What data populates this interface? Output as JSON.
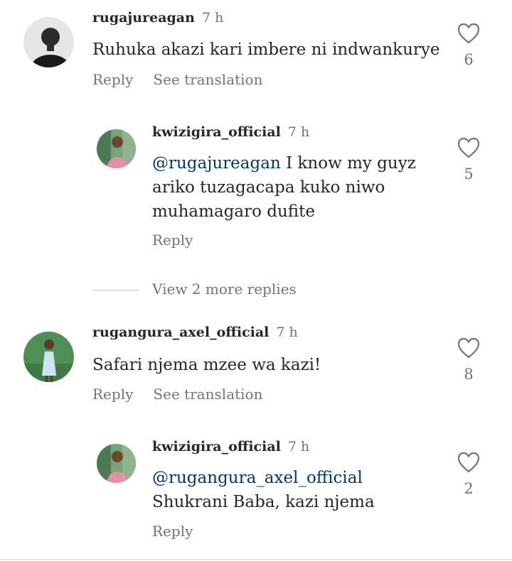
{
  "comments": [
    {
      "username": "rugajureagan",
      "time": "7 h",
      "text": "Ruhuka akazi kari imbere ni indwankurye",
      "reply_label": "Reply",
      "translate_label": "See translation",
      "likes": "6"
    },
    {
      "username": "kwizigira_official",
      "time": "7 h",
      "mention": "@rugajureagan",
      "text": " I know my guyz ariko tuzagacapa kuko niwo muhamagaro dufite",
      "reply_label": "Reply",
      "likes": "5"
    },
    {
      "username": "rugangura_axel_official",
      "time": "7 h",
      "text": "Safari njema mzee wa kazi!",
      "reply_label": "Reply",
      "translate_label": "See translation",
      "likes": "8"
    },
    {
      "username": "kwizigira_official",
      "time": "7 h",
      "mention": "@rugangura_axel_official",
      "text": "Shukrani Baba, kazi njema",
      "reply_label": "Reply",
      "likes": "2"
    }
  ],
  "view_more_replies": "View 2 more replies",
  "colors": {
    "text": "#262626",
    "secondary": "#737373",
    "mention": "#00376b"
  }
}
